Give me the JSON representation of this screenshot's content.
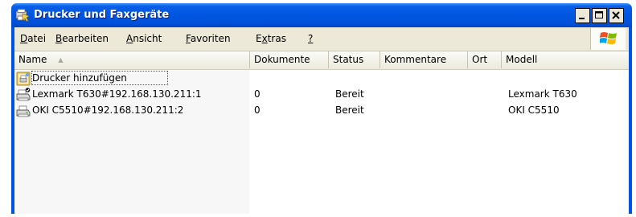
{
  "window": {
    "title": "Drucker und Faxgeräte"
  },
  "menu": {
    "items": [
      {
        "mnemonic": "D",
        "rest": "atei"
      },
      {
        "mnemonic": "B",
        "rest": "earbeiten"
      },
      {
        "mnemonic": "A",
        "rest": "nsicht"
      },
      {
        "mnemonic": "F",
        "rest": "avoriten"
      },
      {
        "pre": "E",
        "mnemonic": "x",
        "rest": "tras"
      },
      {
        "mnemonic": "?",
        "rest": ""
      }
    ]
  },
  "list": {
    "columns": [
      "Name",
      "Dokumente",
      "Status",
      "Kommentare",
      "Ort",
      "Modell"
    ],
    "sorted_column": "Name",
    "sort_direction": "ascending",
    "rows": [
      {
        "name": "Drucker hinzufügen",
        "documents": "",
        "status": "",
        "comment": "",
        "location": "",
        "model": "",
        "icon": "add-printer-icon"
      },
      {
        "name": "Lexmark T630#192.168.130.211:1",
        "documents": "0",
        "status": "Bereit",
        "comment": "",
        "location": "",
        "model": "Lexmark T630",
        "icon": "default-printer-icon"
      },
      {
        "name": "OKI C5510#192.168.130.211:2",
        "documents": "0",
        "status": "Bereit",
        "comment": "",
        "location": "",
        "model": "OKI C5510",
        "icon": "printer-icon"
      }
    ]
  }
}
